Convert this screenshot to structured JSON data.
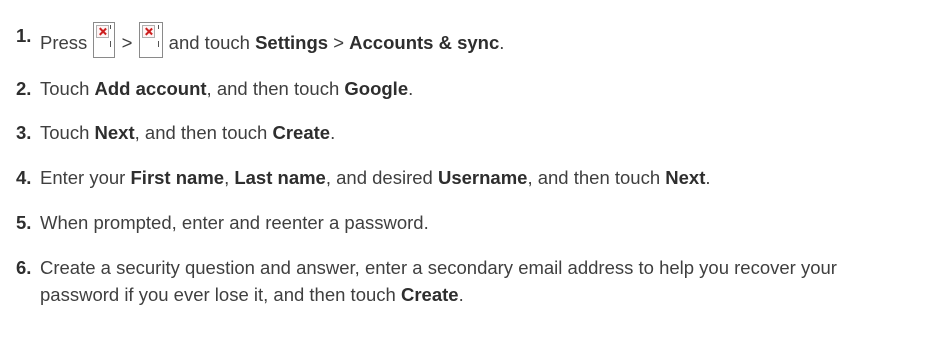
{
  "steps": [
    {
      "number": "1.",
      "parts": [
        {
          "t": "Press ",
          "b": false
        },
        {
          "icon": "broken-image-icon"
        },
        {
          "t": " > ",
          "b": false
        },
        {
          "icon": "broken-image-icon"
        },
        {
          "t": " and touch ",
          "b": false
        },
        {
          "t": "Settings",
          "b": true
        },
        {
          "t": " > ",
          "b": false
        },
        {
          "t": "Accounts & sync",
          "b": true
        },
        {
          "t": ".",
          "b": false
        }
      ]
    },
    {
      "number": "2.",
      "parts": [
        {
          "t": "Touch ",
          "b": false
        },
        {
          "t": "Add account",
          "b": true
        },
        {
          "t": ", and then touch ",
          "b": false
        },
        {
          "t": "Google",
          "b": true
        },
        {
          "t": ".",
          "b": false
        }
      ]
    },
    {
      "number": "3.",
      "parts": [
        {
          "t": "Touch ",
          "b": false
        },
        {
          "t": "Next",
          "b": true
        },
        {
          "t": ", and then touch ",
          "b": false
        },
        {
          "t": "Create",
          "b": true
        },
        {
          "t": ".",
          "b": false
        }
      ]
    },
    {
      "number": "4.",
      "parts": [
        {
          "t": "Enter your ",
          "b": false
        },
        {
          "t": "First name",
          "b": true
        },
        {
          "t": ", ",
          "b": false
        },
        {
          "t": "Last name",
          "b": true
        },
        {
          "t": ", and desired ",
          "b": false
        },
        {
          "t": "Username",
          "b": true
        },
        {
          "t": ", and then touch ",
          "b": false
        },
        {
          "t": "Next",
          "b": true
        },
        {
          "t": ".",
          "b": false
        }
      ]
    },
    {
      "number": "5.",
      "parts": [
        {
          "t": "When prompted, enter and reenter a password.",
          "b": false
        }
      ]
    },
    {
      "number": "6.",
      "parts": [
        {
          "t": "Create a security question and answer, enter a secondary email address to help you recover your password if you ever lose it, and then touch ",
          "b": false
        },
        {
          "t": "Create",
          "b": true
        },
        {
          "t": ".",
          "b": false
        }
      ]
    }
  ],
  "colors": {
    "text": "#3f3f3f",
    "bold_text": "#2e2e2e",
    "broken_image_x": "#cc1f1f"
  }
}
